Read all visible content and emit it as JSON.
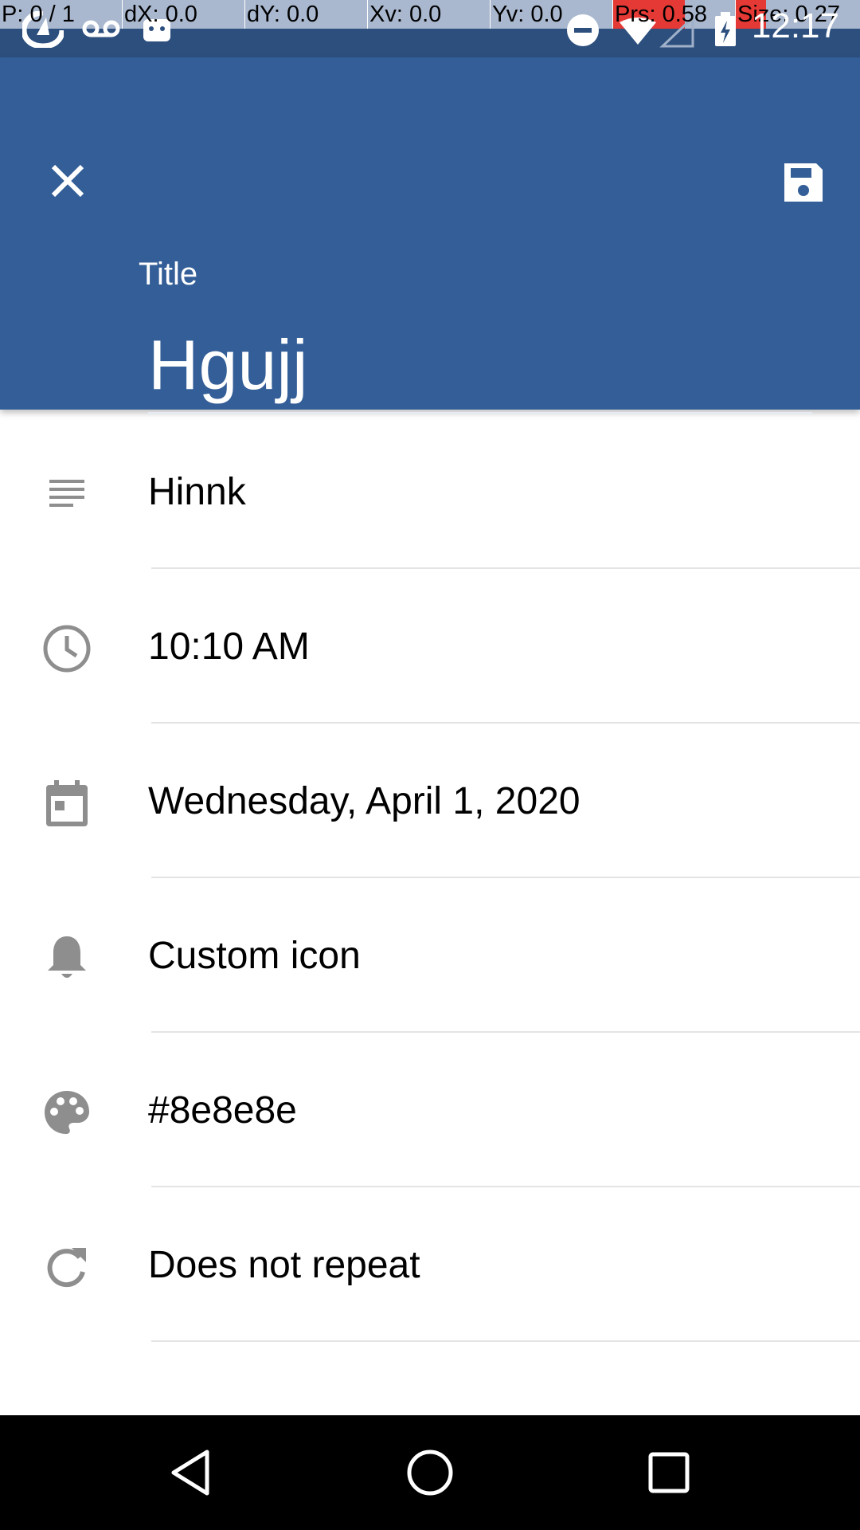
{
  "status_bar": {
    "pointer_info": [
      {
        "label": "P: 0 / 1"
      },
      {
        "label": "dX: 0.0"
      },
      {
        "label": "dY: 0.0"
      },
      {
        "label": "Xv: 0.0"
      },
      {
        "label": "Yv: 0.0"
      },
      {
        "label": "Prs: 0.58"
      },
      {
        "label": "Size: 0.27"
      }
    ],
    "time": "12:17",
    "left_icons": [
      "app-notification-icon",
      "voicemail-icon",
      "android-icon"
    ],
    "right_icons": [
      "do-not-disturb-icon",
      "wifi-icon",
      "cellular-signal-icon",
      "battery-charging-icon"
    ]
  },
  "app_bar": {
    "close_icon": "close-icon",
    "save_icon": "save-icon",
    "title_label": "Title",
    "title_value": "Hgujj",
    "background_color": "#335e97"
  },
  "fields": [
    {
      "icon": "notes-icon",
      "value": "Hinnk"
    },
    {
      "icon": "clock-icon",
      "value": "10:10 AM"
    },
    {
      "icon": "calendar-icon",
      "value": "Wednesday, April 1, 2020"
    },
    {
      "icon": "bell-icon",
      "value": "Custom icon"
    },
    {
      "icon": "palette-icon",
      "value": "#8e8e8e"
    },
    {
      "icon": "repeat-icon",
      "value": "Does not repeat"
    }
  ],
  "nav_bar": {
    "buttons": [
      "back-icon",
      "home-icon",
      "recents-icon"
    ]
  }
}
